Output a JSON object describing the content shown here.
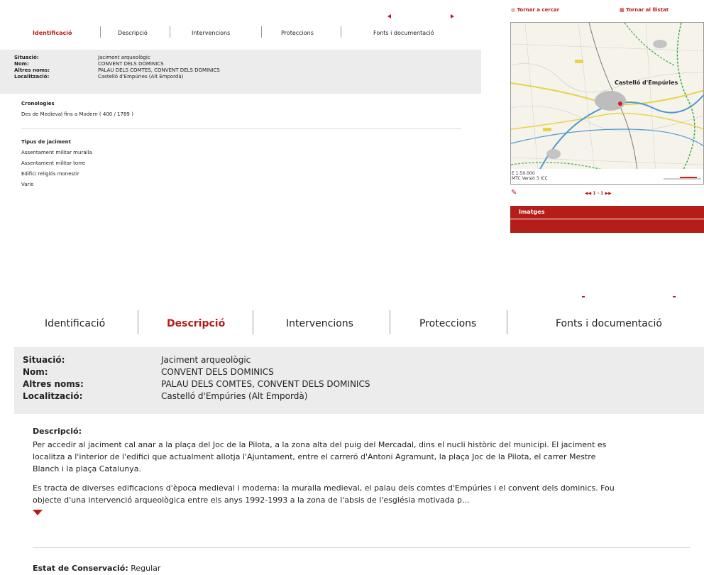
{
  "top_panel": {
    "tabs": [
      "Identificació",
      "Descripció",
      "Intervencions",
      "Proteccions",
      "Fonts i documentació"
    ],
    "active_tab": 0,
    "fields": [
      {
        "label": "Situació:",
        "value": "Jaciment arqueològic"
      },
      {
        "label": "Nom:",
        "value": "CONVENT DELS DOMINICS"
      },
      {
        "label": "Altres noms:",
        "value": "PALAU DELS COMTES, CONVENT DELS DOMINICS"
      },
      {
        "label": "Localització:",
        "value": "Castelló d'Empúries (Alt Empordà)"
      }
    ],
    "cronologies_title": "Cronologies",
    "cronologies_value": "Des de Medieval fins a Modern ( 400 / 1789 )",
    "tipus_title": "Tipus de jaciment",
    "tipus_items": [
      "Assentament militar muralla",
      "Assentament militar torre",
      "Edifici religiós monestir",
      "Varis"
    ]
  },
  "side_panel": {
    "back_search": "Tornar a cercar",
    "back_list": "Tornar al llistat",
    "map_scale": "E 1:50.000",
    "map_source": "MTC Versió 3 ICC",
    "map_town": "Castelló d'Empúries",
    "pager": "1 - 1",
    "images_header": "Imatges",
    "accent_color": "#b51d18"
  },
  "bottom_panel": {
    "tabs": [
      "Identificació",
      "Descripció",
      "Intervencions",
      "Proteccions",
      "Fonts i documentació"
    ],
    "active_tab": 1,
    "fields": [
      {
        "label": "Situació:",
        "value": "Jaciment arqueològic"
      },
      {
        "label": "Nom:",
        "value": "CONVENT DELS DOMINICS"
      },
      {
        "label": "Altres noms:",
        "value": "PALAU DELS COMTES, CONVENT DELS DOMINICS"
      },
      {
        "label": "Localització:",
        "value": "Castelló d'Empúries (Alt Empordà)"
      }
    ],
    "descripcio_title": "Descripció:",
    "descripcio_p1_l1": "Per accedir al jaciment cal anar a la plaça del Joc de la Pilota, a la zona alta del puig del Mercadal, dins el nucli històric del municipi. El jaciment es",
    "descripcio_p1_l2": "localitza a l'interior de l'edifici que actualment allotja l'Ajuntament, entre el carreró d'Antoni Agramunt, la plaça Joc de la Pilota, el carrer Mestre",
    "descripcio_p1_l3": "Blanch i la plaça Catalunya.",
    "descripcio_p2_l1": "Es tracta de diverses edificacions d'època medieval i moderna: la muralla medieval, el palau dels comtes d'Empúries i el convent dels dominics. Fou",
    "descripcio_p2_l2": "objecte d'una intervenció arqueològica entre els anys 1992-1993 a la zona de l'absis de l'església motivada p...",
    "estat_label": "Estat de Conservació:",
    "estat_value": "Regular"
  }
}
